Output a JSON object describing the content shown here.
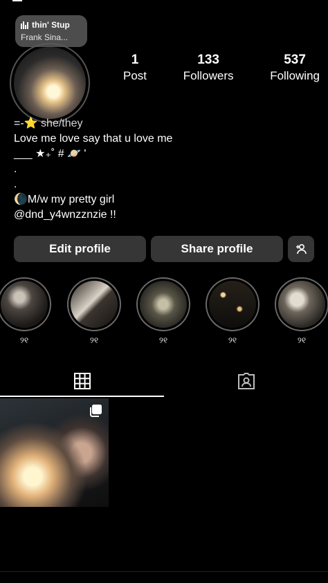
{
  "music": {
    "title": "thin' Stup",
    "artist": "Frank Sina..."
  },
  "stats": [
    {
      "num": "1",
      "label": "Post"
    },
    {
      "num": "133",
      "label": "Followers"
    },
    {
      "num": "537",
      "label": "Following"
    }
  ],
  "bio": {
    "pronouns_prefix": "=-⭐",
    "pronouns": "she/they",
    "line1": "Love me love say that u love me",
    "line2": "___ ★₊˚ # 🪐 '",
    "line3": ".",
    "line4": ".",
    "line5": "🌘M/w my pretty girl",
    "line6": "@dnd_y4wnzznzie !!"
  },
  "buttons": {
    "edit": "Edit profile",
    "share": "Share profile"
  },
  "highlights": [
    {
      "label": "୨୧"
    },
    {
      "label": "୨୧"
    },
    {
      "label": "୨୧"
    },
    {
      "label": "୨୧"
    },
    {
      "label": "୨୧"
    }
  ]
}
